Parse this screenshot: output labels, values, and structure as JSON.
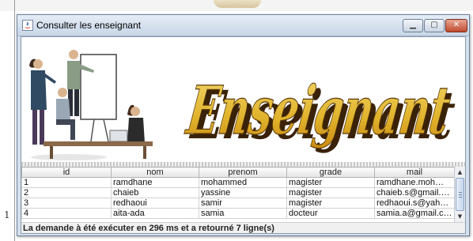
{
  "window": {
    "title": "Consulter les enseignant"
  },
  "banner": {
    "title": "Enseignant",
    "icon": "teachers-meeting-illustration"
  },
  "table": {
    "columns": [
      "id",
      "nom",
      "prenom",
      "grade",
      "mail"
    ],
    "rows": [
      [
        "1",
        "ramdhane",
        "mohammed",
        "magister",
        "ramdhane.moh@h..."
      ],
      [
        "2",
        "chaieb",
        "yassine",
        "magister",
        "chaieb.s@gmail.co..."
      ],
      [
        "3",
        "redhaoui",
        "samir",
        "magister",
        "redhaoui.s@yahoo.fr"
      ],
      [
        "4",
        "aita-ada",
        "samia",
        "docteur",
        "samia.a@gmail.com"
      ]
    ]
  },
  "status": {
    "text": "La demande à été exécuter en 296 ms et a retourné 7 ligne(s)"
  },
  "background": {
    "left_char": "1"
  },
  "colors": {
    "title_gradient_top": "#f2d66a",
    "title_gradient_bottom": "#c98a12",
    "title_shadow": "#3a2208",
    "close_button": "#c04a2f"
  }
}
